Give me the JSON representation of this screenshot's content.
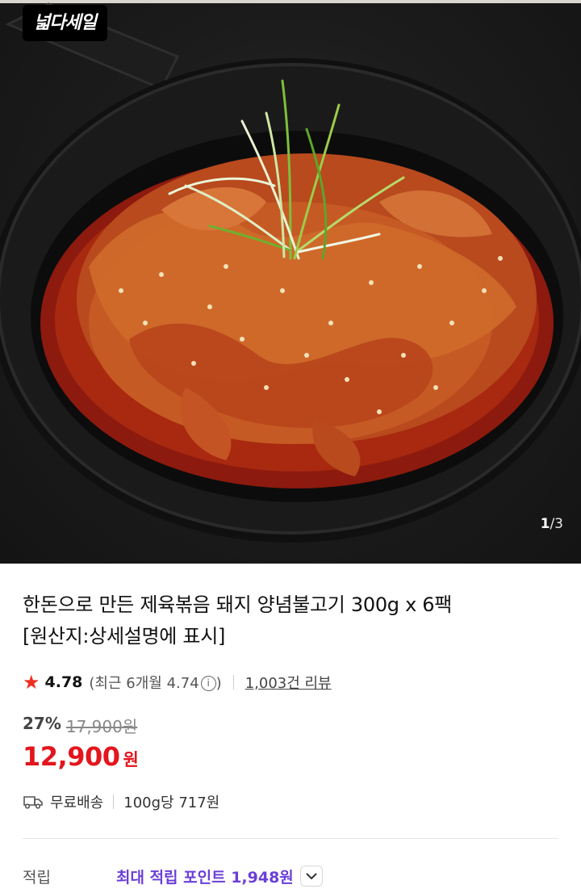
{
  "badge": {
    "label": "넓다세일"
  },
  "gallery": {
    "current": "1",
    "separator": "/",
    "total": "3"
  },
  "product": {
    "title_line1": "한돈으로 만든 제육볶음 돼지 양념불고기 300g x 6팩",
    "title_line2": "[원산지:상세설명에 표시]"
  },
  "rating": {
    "score": "4.78",
    "recent_text": "(최근 6개월 4.74",
    "recent_close": ")",
    "info_symbol": "i",
    "reviews": "1,003건 리뷰"
  },
  "price": {
    "discount": "27%",
    "original": "17,900원",
    "current": "12,900",
    "currency": "원"
  },
  "shipping": {
    "label": "무료배송",
    "unit_price": "100g당 717원"
  },
  "points": {
    "label": "적립",
    "value": "최대 적립 포인트 1,948원"
  },
  "icons": {
    "star": "star-icon",
    "truck": "truck-icon",
    "info": "info-icon",
    "chevron": "chevron-down-icon"
  },
  "colors": {
    "accent_red": "#e4151d",
    "star": "#ef2d21",
    "points_purple": "#6b3fd8"
  }
}
